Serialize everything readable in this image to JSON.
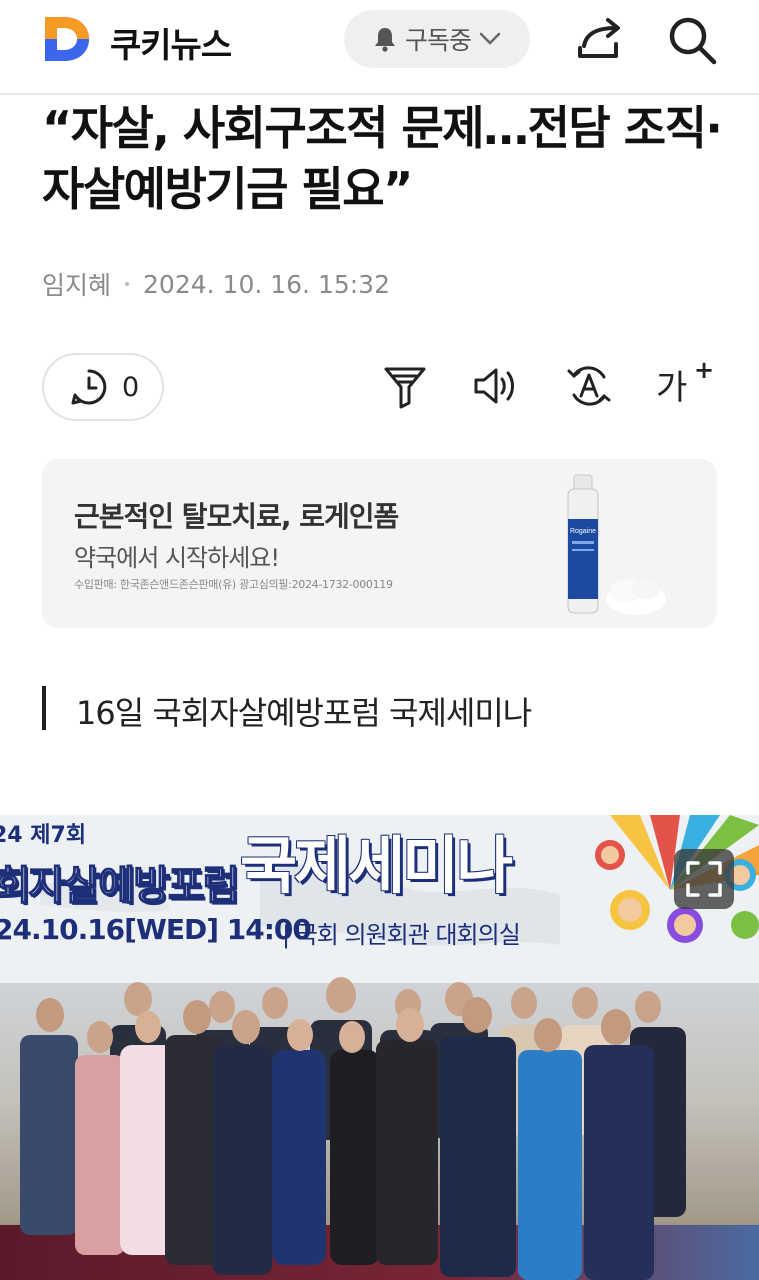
{
  "header": {
    "brand": "쿠키뉴스",
    "subscribe_label": "구독중",
    "colors": {
      "logo_orange": "#f59a23",
      "logo_purple": "#8a4be0",
      "logo_blue": "#2f6bf0"
    }
  },
  "article": {
    "headline": "“자살, 사회구조적 문제…전담 조직·자살예방기금 필요”",
    "author": "임지혜",
    "date": "2024. 10. 16. 15:32",
    "comment_count": "0",
    "font_size_tool": "가",
    "subtitle": "16일 국회자살예방포럼 국제세미나"
  },
  "ad": {
    "title": "근본적인 탈모치료, 로게인폼",
    "subtitle": "약국에서 시작하세요!",
    "fine_print": "수입판매: 한국존슨앤드존슨판매(유) 광고심의필:2024-1732-000119",
    "product_label": "Rogaine"
  },
  "photo": {
    "banner_edition": "24 제7회",
    "banner_forum": "회자살예방포럼",
    "banner_title": "국제세미나",
    "banner_date": "24.10.16[WED] 14:00",
    "banner_place": "| 국회 의원회관 대회의실"
  },
  "icons": [
    "bell-icon",
    "chevron-down-icon",
    "share-icon",
    "search-icon",
    "clock-icon",
    "summary-icon",
    "audio-icon",
    "translate-icon",
    "fullscreen-icon"
  ]
}
